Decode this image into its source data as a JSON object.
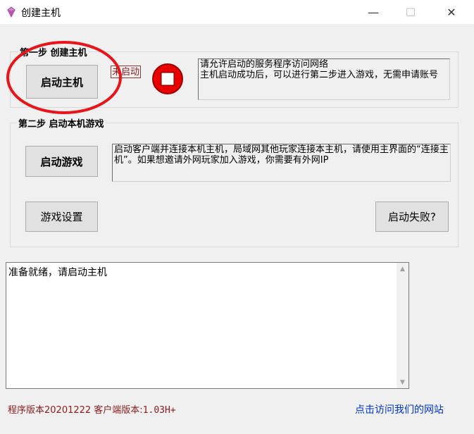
{
  "window": {
    "title": "创建主机",
    "controls": {
      "minimize": "—",
      "maximize": "☐",
      "close": "✕"
    }
  },
  "step1": {
    "title": "第一步 创建主机",
    "start_host_label": "启动主机",
    "status": "未启动",
    "status_icon": "stop-icon",
    "info": "请允许启动的服务程序访问网络\n主机启动成功后，可以进行第二步进入游戏，无需申请账号"
  },
  "step2": {
    "title": "第二步 启动本机游戏",
    "start_game_label": "启动游戏",
    "info": "启动客户端并连接本机主机，局域网其他玩家连接本主机，请使用主界面的“连接主机”。如果想邀请外网玩家加入游戏，你需要有外网IP",
    "settings_label": "游戏设置",
    "failed_label": "启动失败?"
  },
  "log": {
    "text": "准备就绪，请启动主机"
  },
  "footer": {
    "version_prefix": "程序版本20201222 客户端版本:",
    "version_value": "1.03H+",
    "site_link": "点击访问我们的网站"
  },
  "colors": {
    "status_red": "#8b1a1a",
    "link_blue": "#0033cc",
    "annotation_red": "#e8141a"
  }
}
